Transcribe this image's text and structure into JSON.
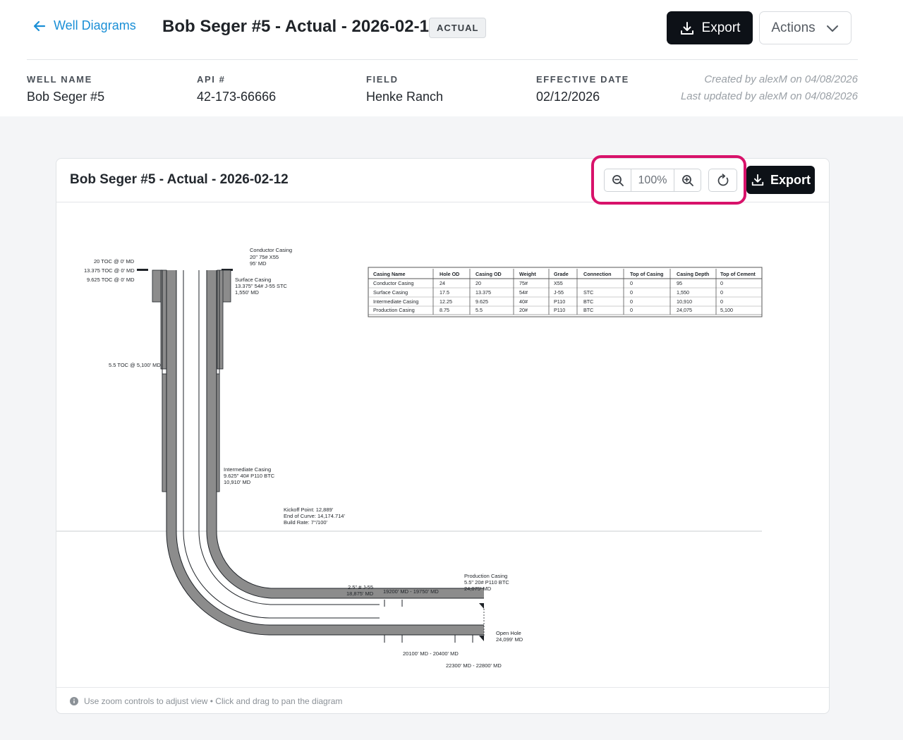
{
  "header": {
    "back_label": "Well Diagrams",
    "title": "Bob Seger #5 - Actual - 2026-02-12",
    "badge": "ACTUAL",
    "export_label": "Export",
    "actions_label": "Actions"
  },
  "meta": {
    "well_name_label": "WELL NAME",
    "well_name": "Bob Seger #5",
    "api_label": "API #",
    "api": "42-173-66666",
    "field_label": "FIELD",
    "field": "Henke Ranch",
    "effective_date_label": "EFFECTIVE DATE",
    "effective_date": "02/12/2026",
    "created": "Created by alexM on 04/08/2026",
    "updated": "Last updated by alexM on 04/08/2026"
  },
  "card": {
    "title": "Bob Seger #5 - Actual - 2026-02-12",
    "zoom_level": "100%",
    "export_label": "Export",
    "footer_hint": "Use zoom controls to adjust view • Click and drag to pan the diagram"
  },
  "diagram": {
    "toc_labels": [
      "20 TOC @ 0' MD",
      "13.375 TOC @ 0' MD",
      "9.625 TOC @ 0' MD"
    ],
    "toc_55": "5.5 TOC @ 5,100' MD",
    "conductor": [
      "Conductor Casing",
      "20\" 75# X55",
      "95' MD"
    ],
    "surface": [
      "Surface Casing",
      "13.375\" 54# J-55 STC",
      "1,550' MD"
    ],
    "intermediate": [
      "Intermediate Casing",
      "9.625\" 40# P110 BTC",
      "10,910' MD"
    ],
    "kickoff": [
      "Kickoff Point: 12,889'",
      "End of Curve: 14,174.714'",
      "Build Rate: 7°/100'"
    ],
    "tubing": [
      "2.5\" # J-55",
      "18,875' MD"
    ],
    "perf_top": "19200' MD - 19750' MD",
    "perf_bottom_1": "20100' MD - 20400' MD",
    "perf_bottom_2": "22300' MD - 22800' MD",
    "production": [
      "Production Casing",
      "5.5\" 20# P110 BTC",
      "24,075' MD"
    ],
    "open_hole": [
      "Open Hole",
      "24,099' MD"
    ],
    "table": {
      "headers": [
        "Casing Name",
        "Hole OD",
        "Casing OD",
        "Weight",
        "Grade",
        "Connection",
        "Top of Casing",
        "Casing Depth",
        "Top of Cement"
      ],
      "rows": [
        [
          "Conductor Casing",
          "24",
          "20",
          "75#",
          "X55",
          "",
          "0",
          "95",
          "0"
        ],
        [
          "Surface Casing",
          "17.5",
          "13.375",
          "54#",
          "J-55",
          "STC",
          "0",
          "1,550",
          "0"
        ],
        [
          "Intermediate Casing",
          "12.25",
          "9.625",
          "40#",
          "P110",
          "BTC",
          "0",
          "10,910",
          "0"
        ],
        [
          "Production Casing",
          "8.75",
          "5.5",
          "20#",
          "P110",
          "BTC",
          "0",
          "24,075",
          "5,100"
        ]
      ]
    }
  }
}
